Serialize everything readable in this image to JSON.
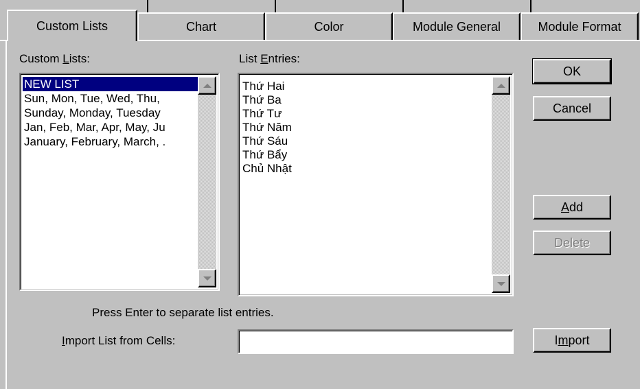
{
  "tabs": [
    {
      "label": "Custom Lists",
      "active": true
    },
    {
      "label": "Chart",
      "active": false
    },
    {
      "label": "Color",
      "active": false
    },
    {
      "label": "Module General",
      "active": false
    },
    {
      "label": "Module Format",
      "active": false
    }
  ],
  "custom_lists": {
    "label_pre": "Custom ",
    "label_hot": "L",
    "label_post": "ists:",
    "items": [
      "NEW LIST",
      "Sun, Mon, Tue, Wed, Thu,",
      "Sunday, Monday, Tuesday",
      "Jan, Feb, Mar, Apr, May, Ju",
      "January, February, March, ."
    ],
    "selected": "NEW LIST"
  },
  "list_entries": {
    "label_pre": "List ",
    "label_hot": "E",
    "label_post": "ntries:",
    "items": [
      "Thứ Hai",
      "Thứ Ba",
      "Thứ Tư",
      "Thứ Năm",
      "Thứ Sáu",
      "Thứ Bẩy",
      "Chủ Nhật"
    ]
  },
  "buttons": {
    "ok": "OK",
    "cancel": "Cancel",
    "add_hot": "A",
    "add_rest": "dd",
    "delete": "Delete",
    "import_pre": "I",
    "import_hot": "m",
    "import_post": "port"
  },
  "hint": "Press Enter to separate list entries.",
  "import_field": {
    "label_hot": "I",
    "label_rest": "mport List from Cells:",
    "value": ""
  },
  "colors": {
    "dialog_bg": "#c0c0c0",
    "selection_bg": "#000080",
    "selection_fg": "#ffffff"
  }
}
